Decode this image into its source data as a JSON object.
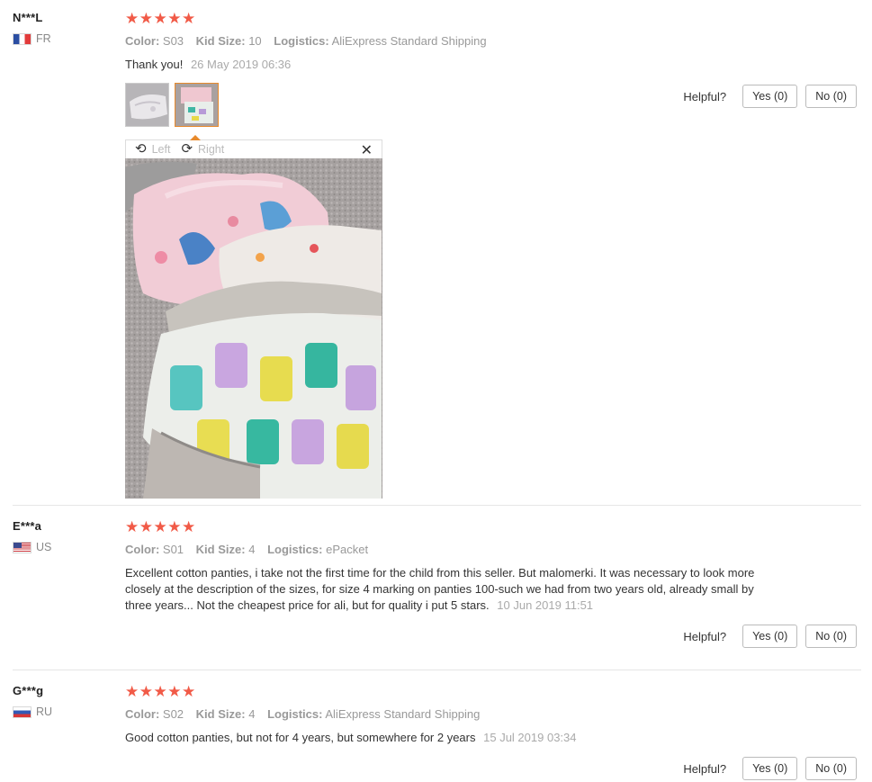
{
  "colors": {
    "star": "#f15a47",
    "accent": "#e88a2c"
  },
  "reviews": [
    {
      "user": "N***L",
      "country": "FR",
      "stars": "★★★★★",
      "color_label": "Color:",
      "color_value": "S03",
      "size_label": "Kid Size:",
      "size_value": "10",
      "logistics_label": "Logistics:",
      "logistics_value": "AliExpress Standard Shipping",
      "text": "Thank you!",
      "date": "26 May 2019 06:36",
      "helpful_label": "Helpful?",
      "yes_label": "Yes (0)",
      "no_label": "No (0)"
    },
    {
      "user": "E***a",
      "country": "US",
      "stars": "★★★★★",
      "color_label": "Color:",
      "color_value": "S01",
      "size_label": "Kid Size:",
      "size_value": "4",
      "logistics_label": "Logistics:",
      "logistics_value": "ePacket",
      "text": "Excellent cotton panties, i take not the first time for the child from this seller. But malomerki. It was necessary to look more closely at the description of the sizes, for size 4 marking on panties 100-such we had from two years old, already small by three years... Not the cheapest price for ali, but for quality i put 5 stars.",
      "date": "10 Jun 2019 11:51",
      "helpful_label": "Helpful?",
      "yes_label": "Yes (0)",
      "no_label": "No (0)"
    },
    {
      "user": "G***g",
      "country": "RU",
      "stars": "★★★★★",
      "color_label": "Color:",
      "color_value": "S02",
      "size_label": "Kid Size:",
      "size_value": "4",
      "logistics_label": "Logistics:",
      "logistics_value": "AliExpress Standard Shipping",
      "text": "Good cotton panties, but not for 4 years, but somewhere for 2 years",
      "date": "15 Jul 2019 03:34",
      "helpful_label": "Helpful?",
      "yes_label": "Yes (0)",
      "no_label": "No (0)"
    }
  ],
  "viewer": {
    "rotate_left_label": "Left",
    "rotate_right_label": "Right",
    "close_symbol": "✕"
  }
}
